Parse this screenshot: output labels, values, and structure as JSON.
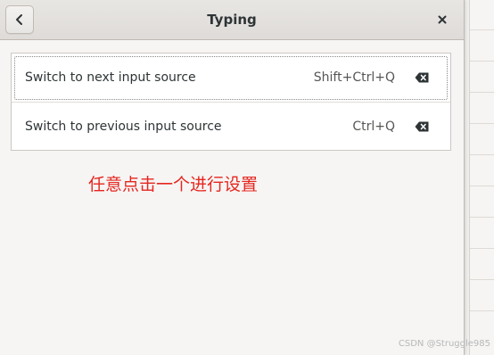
{
  "dialog": {
    "title": "Typing",
    "back_icon": "chevron-left-icon",
    "close_icon": "close-icon"
  },
  "shortcuts": [
    {
      "label": "Switch to next input source",
      "accelerator": "Shift+Ctrl+Q",
      "clear_icon": "backspace-clear-icon",
      "focused": true
    },
    {
      "label": "Switch to previous input source",
      "accelerator": "Ctrl+Q",
      "clear_icon": "backspace-clear-icon",
      "focused": false
    }
  ],
  "annotation": {
    "text": "任意点击一个进行设置",
    "color": "#e5261f"
  },
  "watermark": {
    "text": "CSDN @Struggle985"
  },
  "colors": {
    "headerbar": "#dedbd8",
    "window_bg": "#f6f5f4",
    "list_bg": "#ffffff",
    "text": "#2e3436"
  }
}
